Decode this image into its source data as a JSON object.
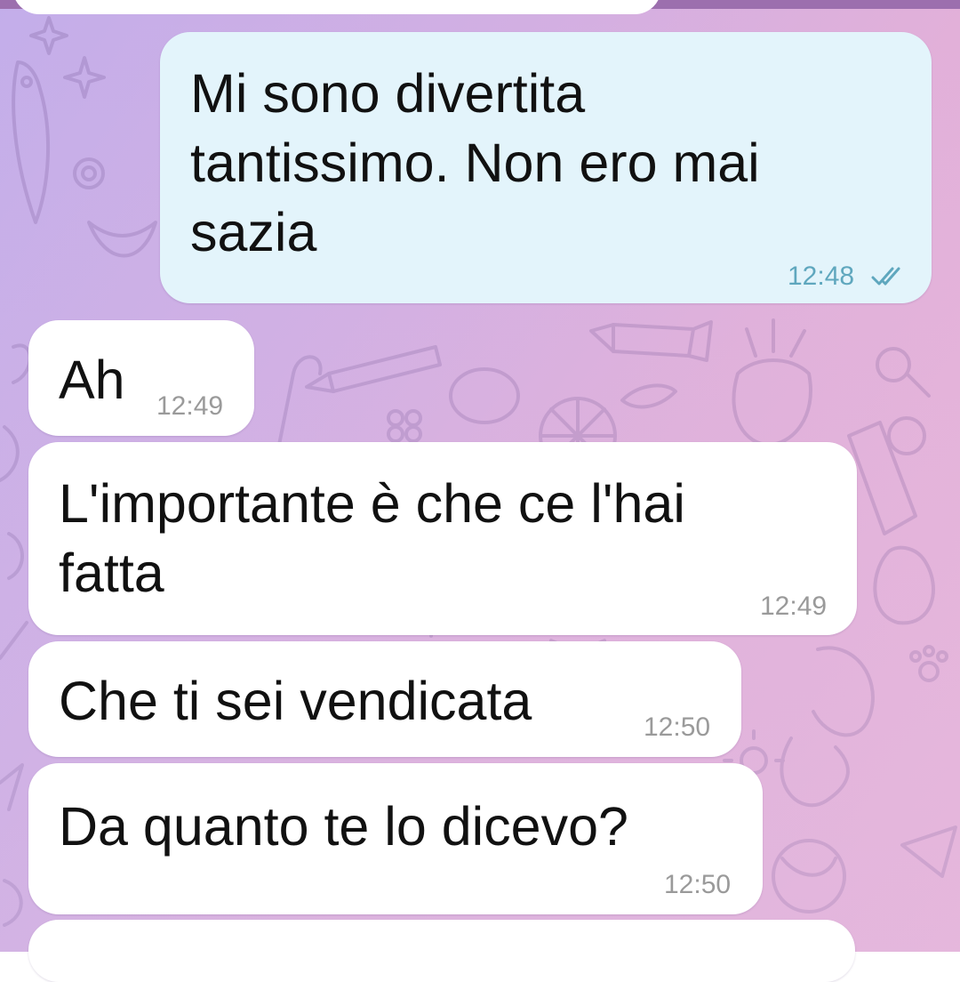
{
  "theme": {
    "accent_outgoing_time": "#5fa7be",
    "bubble_outgoing": "#e3f4fb",
    "bubble_incoming": "#ffffff"
  },
  "messages": [
    {
      "direction": "outgoing",
      "text": "Mi sono divertita\ntantissimo. Non ero mai\nsazia",
      "time": "12:48",
      "status_icon": "double-check-icon"
    },
    {
      "direction": "incoming",
      "text": "Ah",
      "time": "12:49"
    },
    {
      "direction": "incoming",
      "text": "L'importante è che ce l'hai\nfatta",
      "time": "12:49"
    },
    {
      "direction": "incoming",
      "text": "Che ti sei vendicata",
      "time": "12:50"
    },
    {
      "direction": "incoming",
      "text": "Da quanto te lo dicevo?",
      "time": "12:50"
    }
  ]
}
